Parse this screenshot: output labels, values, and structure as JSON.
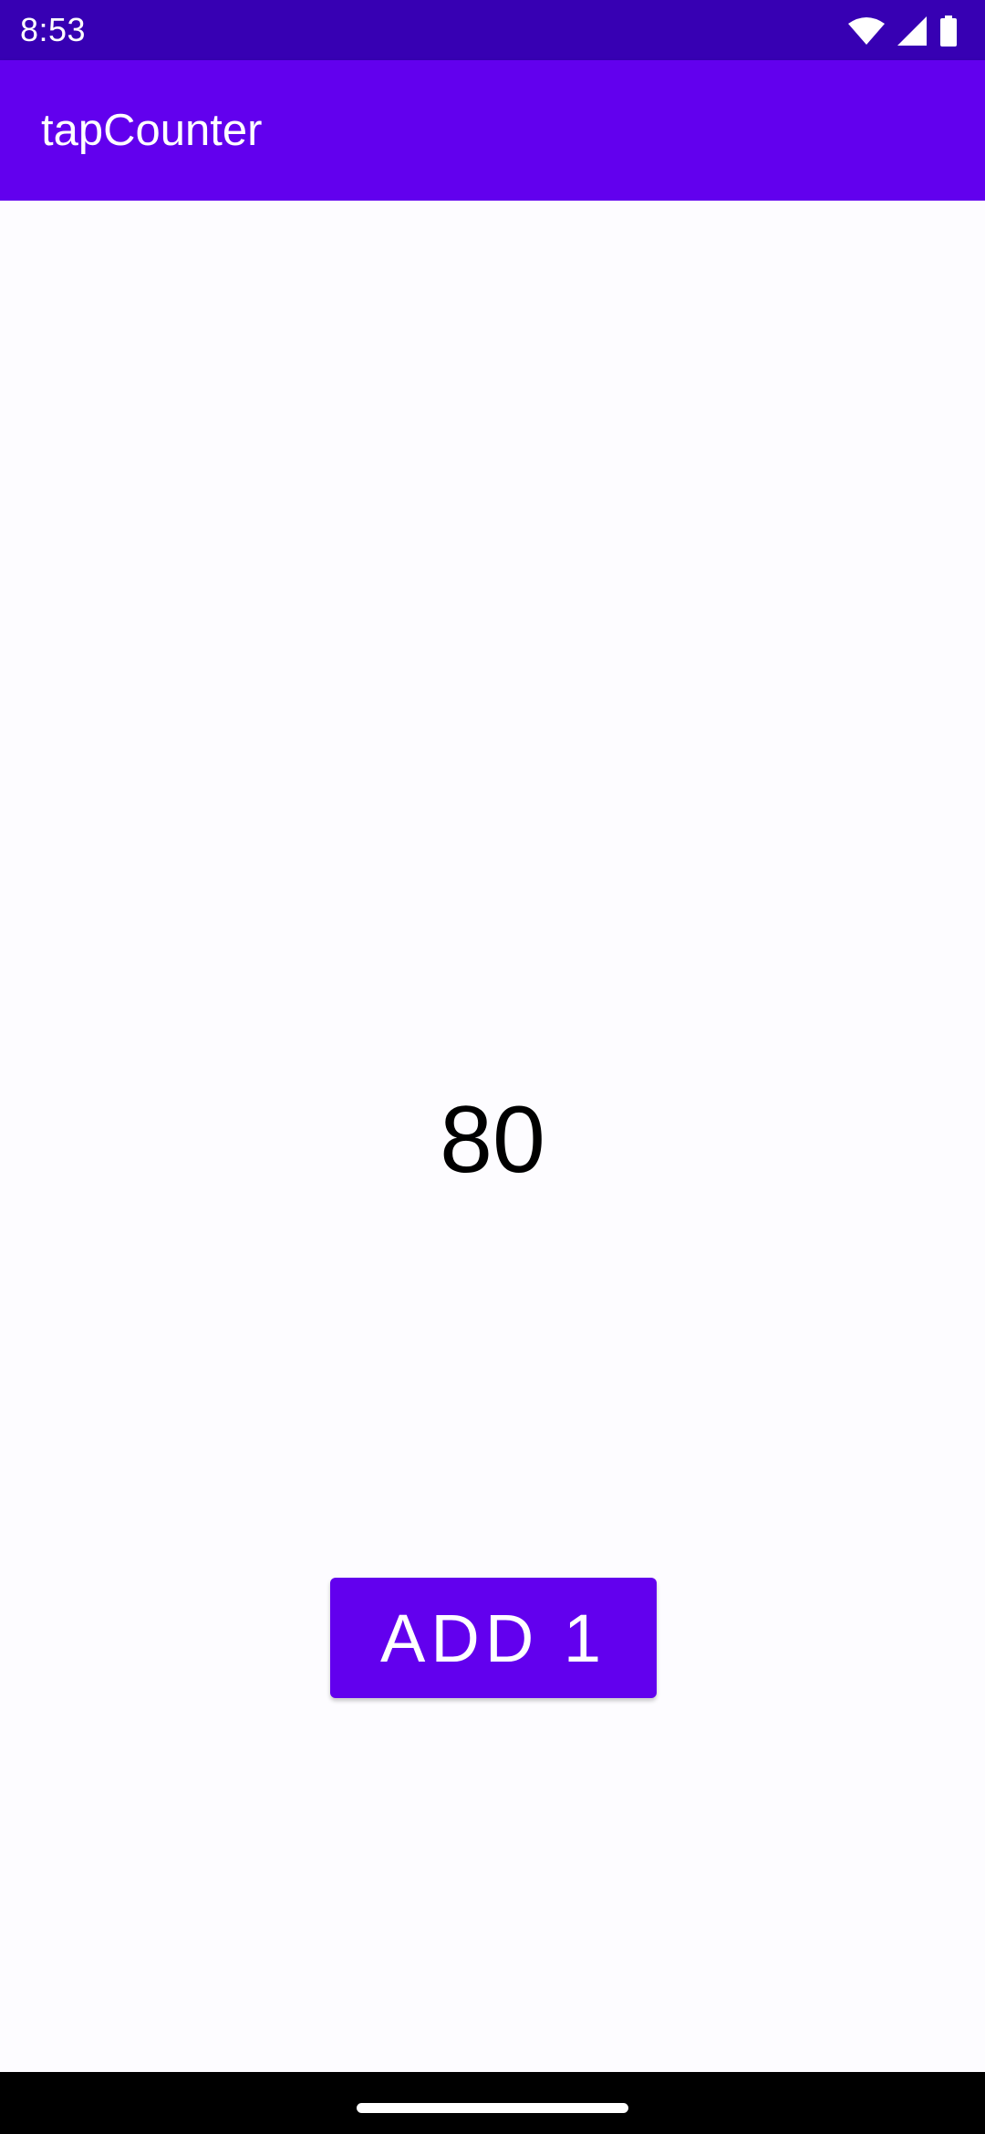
{
  "status_bar": {
    "time": "8:53",
    "background_color": "#3700b3",
    "icons": [
      "wifi-icon",
      "cellular-signal-icon",
      "battery-icon"
    ]
  },
  "app_bar": {
    "title": "tapCounter",
    "background_color": "#6200ee"
  },
  "main": {
    "counter_value": "80",
    "add_button_label": "ADD 1",
    "accent_color": "#6200ee"
  },
  "nav_bar": {
    "handle": "home-gesture-handle"
  }
}
